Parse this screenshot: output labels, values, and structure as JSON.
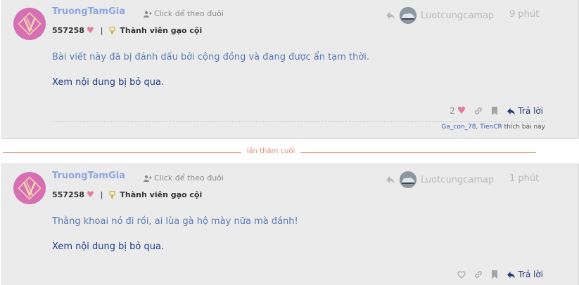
{
  "posts": [
    {
      "username": "TruongTamGia",
      "follow_label": "Click để theo đuôi",
      "points": "557258",
      "rank": "Thành viên gạo cội",
      "reply_to_user": "Luotcungcamap",
      "time": "9 phút",
      "content": "Bài viết này đã bị đánh dấu bởi cộng đồng và đang được ẩn tạm thời.",
      "show_hidden_label": "Xem nội dung bị bỏ qua.",
      "like_count": "2",
      "reply_label": "Trả lời",
      "liked_by": [
        "Ga_con_78",
        "TienCR"
      ],
      "liked_by_sep": ",",
      "liked_by_suffix": "thích bài này"
    },
    {
      "username": "TruongTamGia",
      "follow_label": "Click để theo đuôi",
      "points": "557258",
      "rank": "Thành viên gạo cội",
      "reply_to_user": "Luotcungcamap",
      "time": "1 phút",
      "content": "Thằng khoai nó đi rồi, ai lùa gà hộ mày nữa mà đánh!",
      "show_hidden_label": "Xem nội dung bị bỏ qua.",
      "reply_label": "Trả lời"
    }
  ],
  "last_read_label": "lần thăm cuối",
  "colors": {
    "username": "#8fa5e0",
    "link": "#1e3c8c",
    "content": "#5a7ab5",
    "heart": "#e87b9b",
    "last_read": "#e9896b",
    "avatar_bg": "#d66fb4",
    "post_bg": "#ebebeb"
  },
  "icons": {
    "follow": "user-plus-icon",
    "heart": "heart-icon",
    "rank": "medal-icon",
    "reply_arrow": "reply-arrow-icon",
    "link": "link-icon",
    "bookmark": "bookmark-icon",
    "reply": "reply-icon"
  }
}
